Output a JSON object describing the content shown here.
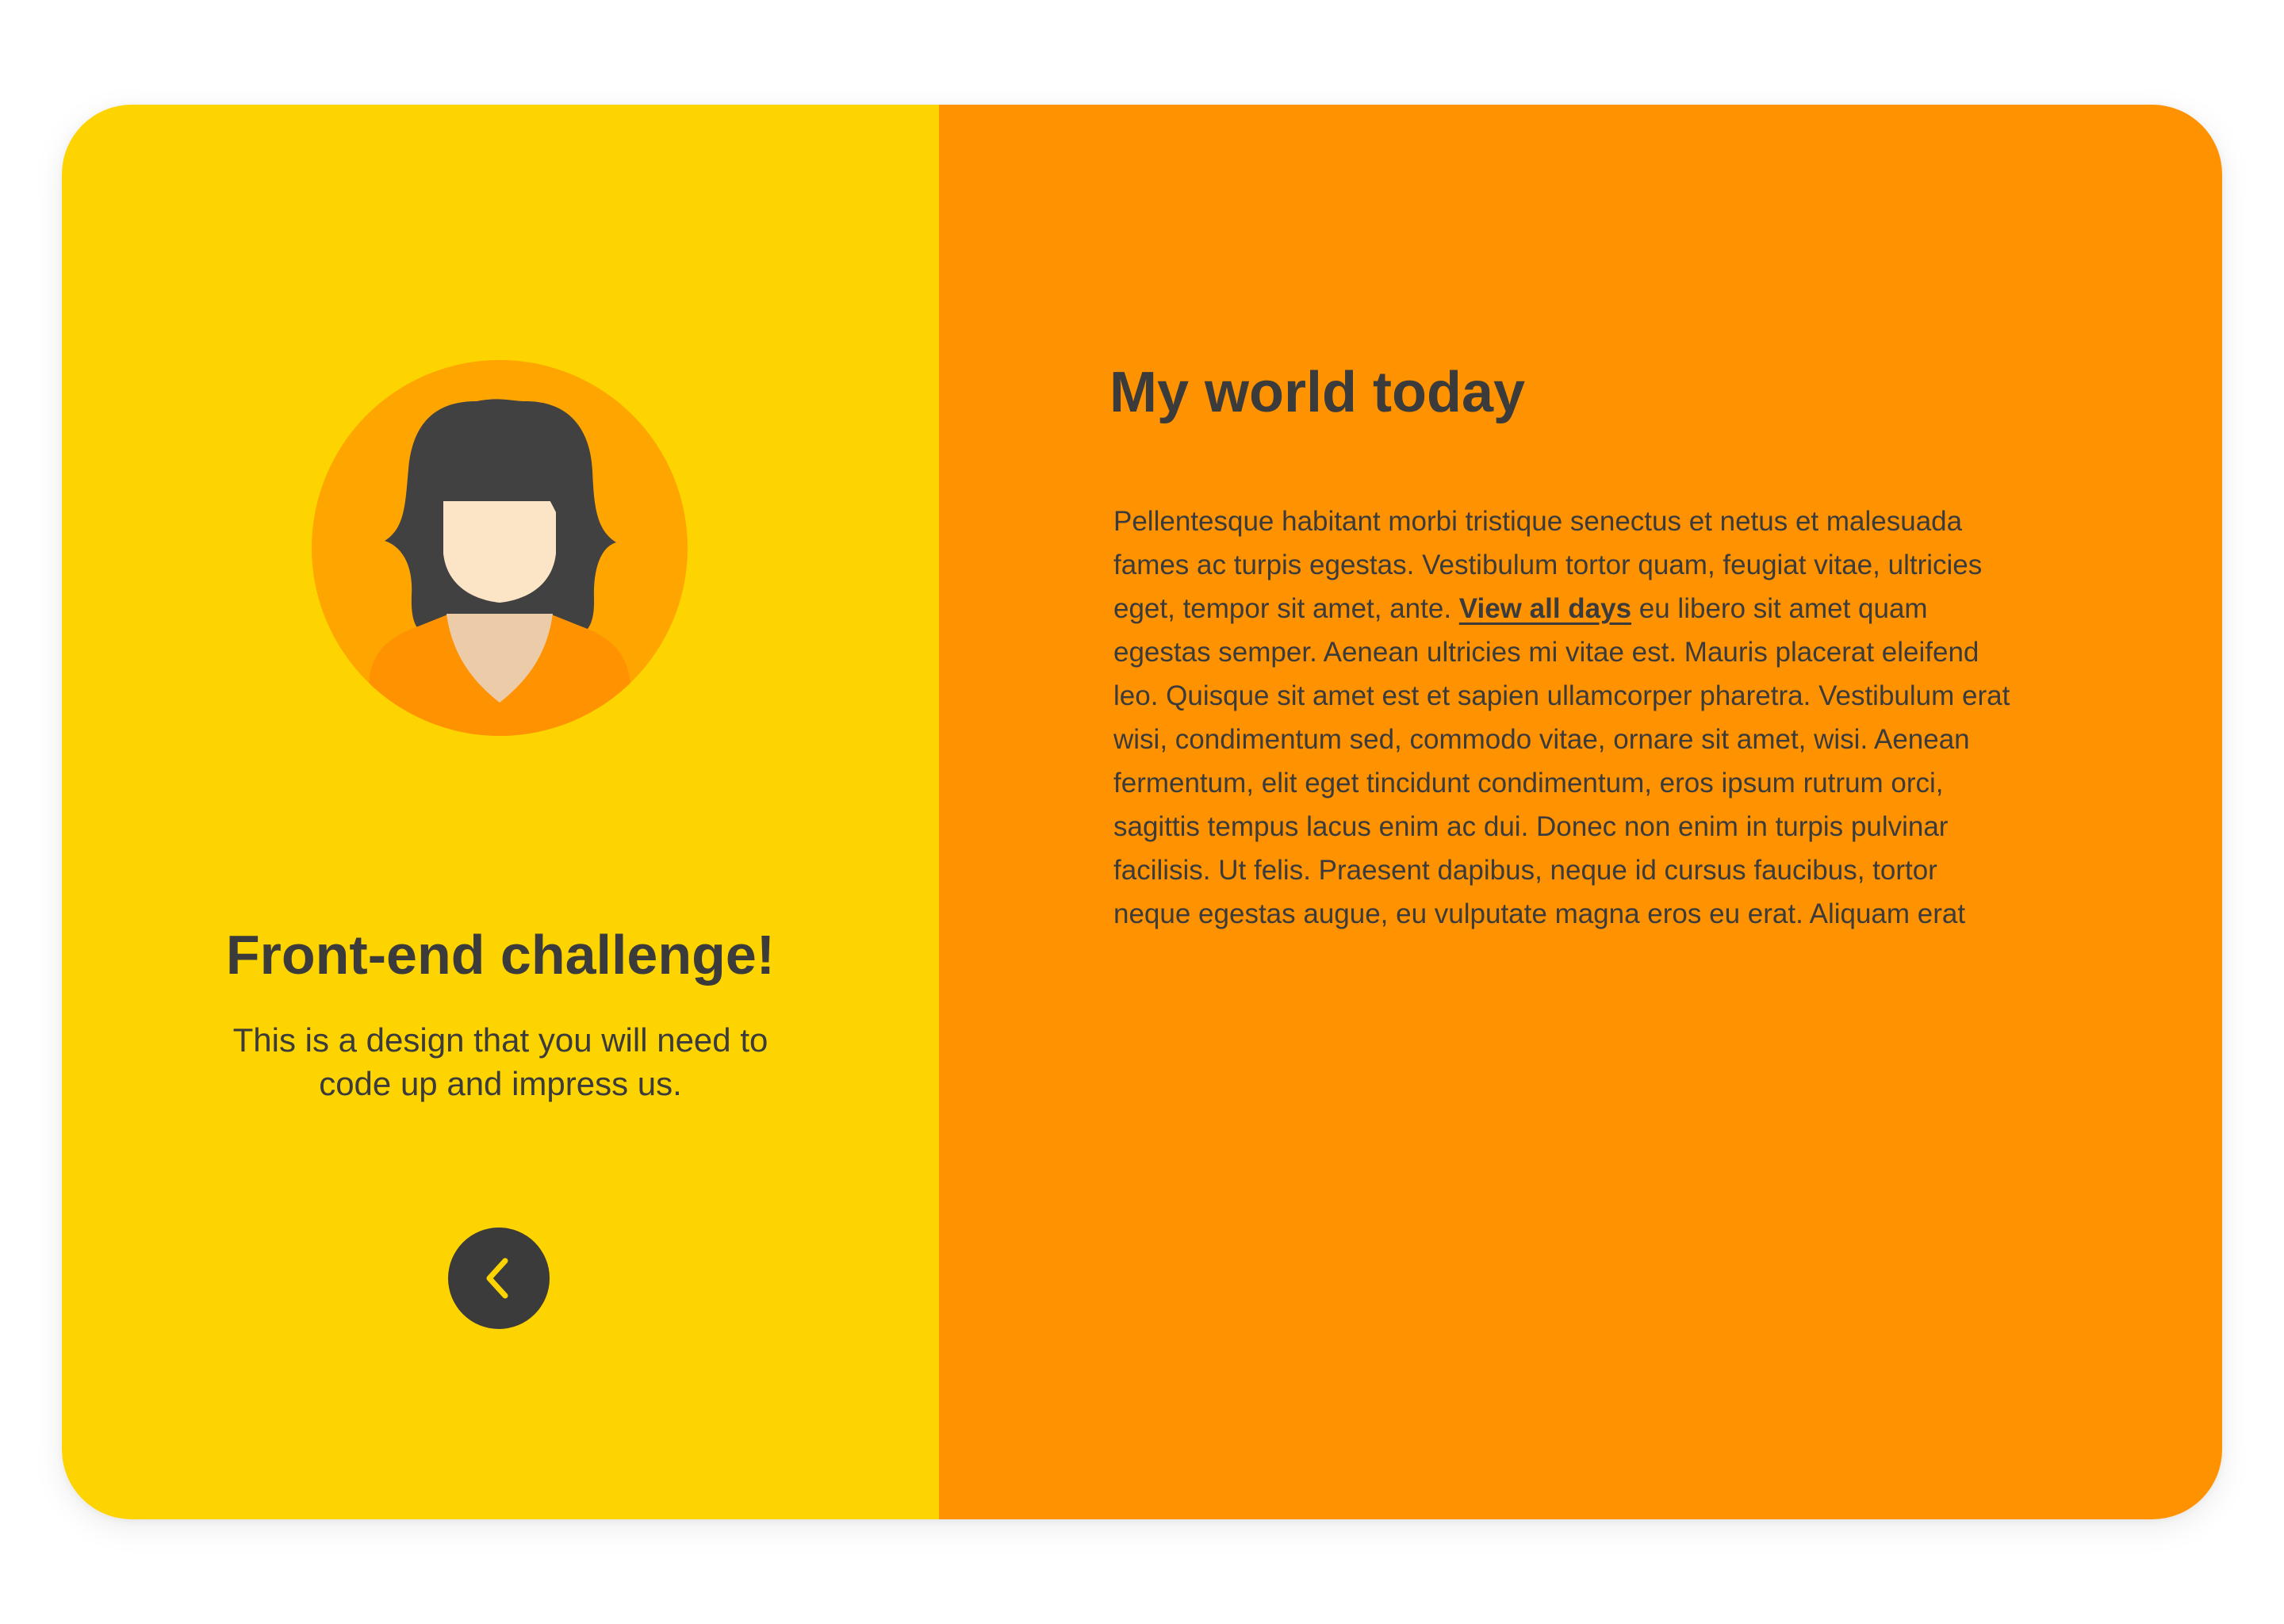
{
  "colors": {
    "left_panel": "#fdd400",
    "right_panel": "#ff9200",
    "text": "#3b3b3b",
    "button_bg": "#3b3b3b",
    "button_icon": "#fdd400"
  },
  "left_panel": {
    "avatar_icon": "woman-avatar-icon",
    "title": "Front-end challenge!",
    "description": "This is a design that you will need to code up and impress us.",
    "back_button_icon": "chevron-left-icon"
  },
  "right_panel": {
    "title": "My world today",
    "paragraph_before_link": "Pellentesque habitant morbi tristique senectus et netus et malesuada fames ac turpis egestas. Vestibulum tortor quam, feugiat vitae, ultricies eget, tempor sit amet, ante. ",
    "link_text": "View all days",
    "paragraph_after_link": " eu libero sit amet quam egestas semper. Aenean ultricies mi vitae est. Mauris placerat eleifend leo. Quisque sit amet est et sapien ullamcorper pharetra. Vestibulum erat wisi, condimentum sed, commodo vitae, ornare sit amet, wisi. Aenean fermentum, elit eget tincidunt condimentum, eros ipsum rutrum orci, sagittis tempus lacus enim ac dui. Donec non enim in turpis pulvinar facilisis. Ut felis. Praesent dapibus, neque id cursus faucibus, tortor neque egestas augue, eu vulputate magna eros eu erat. Aliquam erat"
  }
}
